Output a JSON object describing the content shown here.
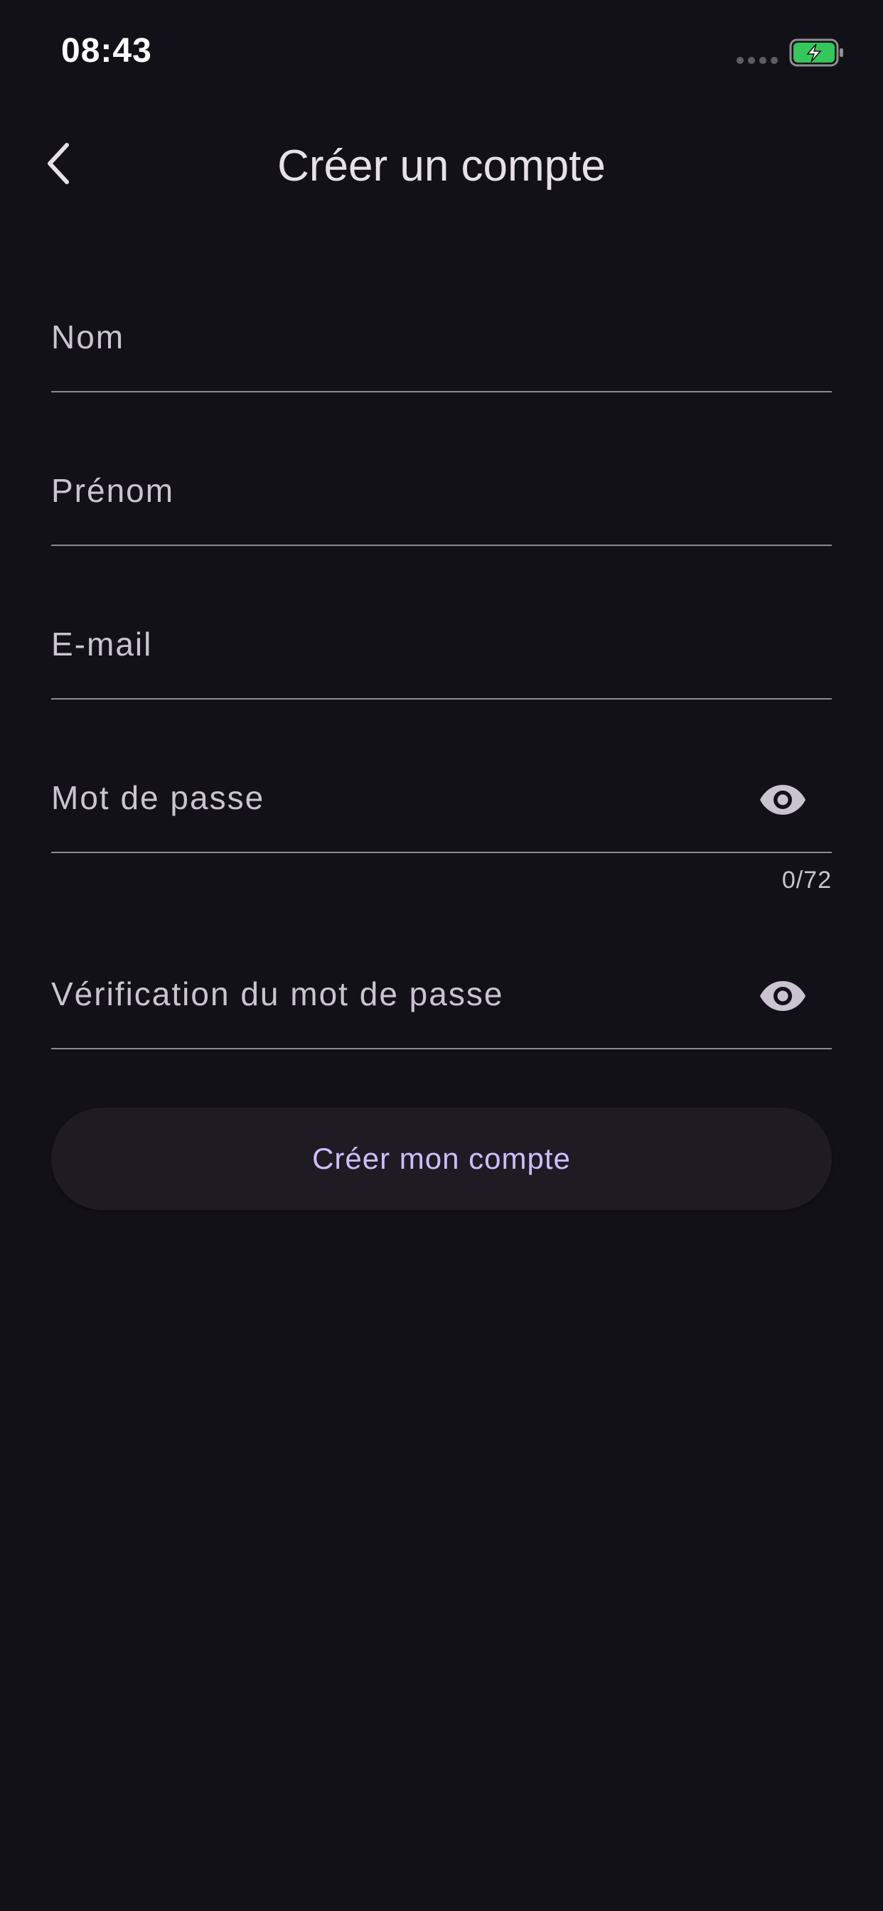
{
  "status_bar": {
    "time": "08:43"
  },
  "header": {
    "title": "Créer un compte"
  },
  "form": {
    "last_name": {
      "placeholder": "Nom",
      "value": ""
    },
    "first_name": {
      "placeholder": "Prénom",
      "value": ""
    },
    "email": {
      "placeholder": "E-mail",
      "value": ""
    },
    "password": {
      "placeholder": "Mot de passe",
      "value": "",
      "counter": "0/72"
    },
    "password_confirm": {
      "placeholder": "Vérification du mot de passe",
      "value": ""
    },
    "submit_label": "Créer mon compte"
  },
  "icons": {
    "back": "chevron-left-icon",
    "password_toggle": "eye-icon",
    "battery": "battery-charging-icon"
  },
  "colors": {
    "background": "#131118",
    "accent": "#cfbcff",
    "battery_green": "#34c759"
  }
}
